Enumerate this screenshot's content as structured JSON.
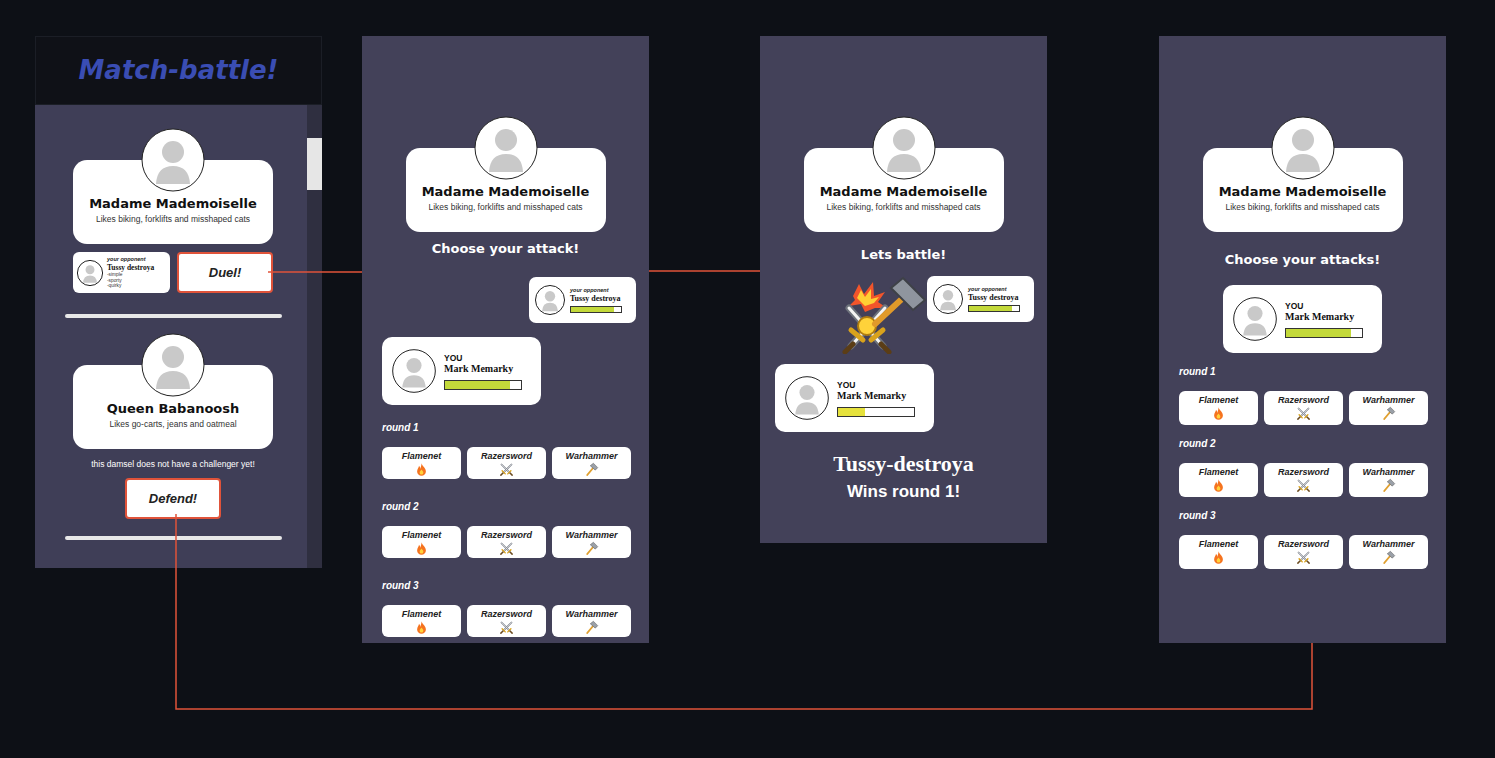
{
  "screens": [
    {
      "kind": "lobby",
      "header": "Match-battle!",
      "damsels": [
        {
          "name": "Madame Mademoiselle",
          "tagline": "Likes biking, forklifts and misshaped cats",
          "opponent": {
            "label": "your opponent",
            "name": "Tussy destroya",
            "traits": [
              "-simple",
              "-sporty",
              "-quirky"
            ]
          },
          "action": "Duel!"
        },
        {
          "name": "Queen Babanoosh",
          "tagline": "Likes go-carts, jeans and oatmeal",
          "notice": "this damsel does not have a challenger yet!",
          "action": "Defend!"
        }
      ]
    },
    {
      "kind": "attack",
      "damsel": {
        "name": "Madame Mademoiselle",
        "tagline": "Likes biking, forklifts and misshaped cats"
      },
      "prompt": "Choose your attack!",
      "opponent": {
        "label": "your opponent",
        "name": "Tussy destroya",
        "level": 0.85
      },
      "player": {
        "label": "YOU",
        "name": "Mark Memarky",
        "level": 0.86
      },
      "rounds": [
        {
          "label": "round 1",
          "attacks": [
            {
              "name": "Flamenet",
              "kind": "fire"
            },
            {
              "name": "Razersword",
              "kind": "sword"
            },
            {
              "name": "Warhammer",
              "kind": "hammer"
            }
          ]
        },
        {
          "label": "round 2",
          "attacks": [
            {
              "name": "Flamenet",
              "kind": "fire"
            },
            {
              "name": "Razersword",
              "kind": "sword"
            },
            {
              "name": "Warhammer",
              "kind": "hammer"
            }
          ]
        },
        {
          "label": "round 3",
          "attacks": [
            {
              "name": "Flamenet",
              "kind": "fire"
            },
            {
              "name": "Razersword",
              "kind": "sword"
            },
            {
              "name": "Warhammer",
              "kind": "hammer"
            }
          ]
        }
      ]
    },
    {
      "kind": "battle",
      "damsel": {
        "name": "Madame Mademoiselle",
        "tagline": "Likes biking, forklifts and misshaped cats"
      },
      "prompt": "Lets battle!",
      "opponent": {
        "label": "your opponent",
        "name": "Tussy destroya",
        "level": 0.85
      },
      "player": {
        "label": "YOU",
        "name": "Mark Memarky",
        "level": 0.36
      },
      "winner": "Tussy-destroya",
      "result": "Wins round 1!"
    },
    {
      "kind": "attacks",
      "damsel": {
        "name": "Madame Mademoiselle",
        "tagline": "Likes biking, forklifts and misshaped cats"
      },
      "prompt": "Choose your attacks!",
      "player": {
        "label": "YOU",
        "name": "Mark Memarky",
        "level": 0.86
      },
      "rounds": [
        {
          "label": "round 1",
          "attacks": [
            {
              "name": "Flamenet",
              "kind": "fire"
            },
            {
              "name": "Razersword",
              "kind": "sword"
            },
            {
              "name": "Warhammer",
              "kind": "hammer"
            }
          ]
        },
        {
          "label": "round 2",
          "attacks": [
            {
              "name": "Flamenet",
              "kind": "fire"
            },
            {
              "name": "Razersword",
              "kind": "sword"
            },
            {
              "name": "Warhammer",
              "kind": "hammer"
            }
          ]
        },
        {
          "label": "round 3",
          "attacks": [
            {
              "name": "Flamenet",
              "kind": "fire"
            },
            {
              "name": "Razersword",
              "kind": "sword"
            },
            {
              "name": "Warhammer",
              "kind": "hammer"
            }
          ]
        }
      ]
    }
  ]
}
